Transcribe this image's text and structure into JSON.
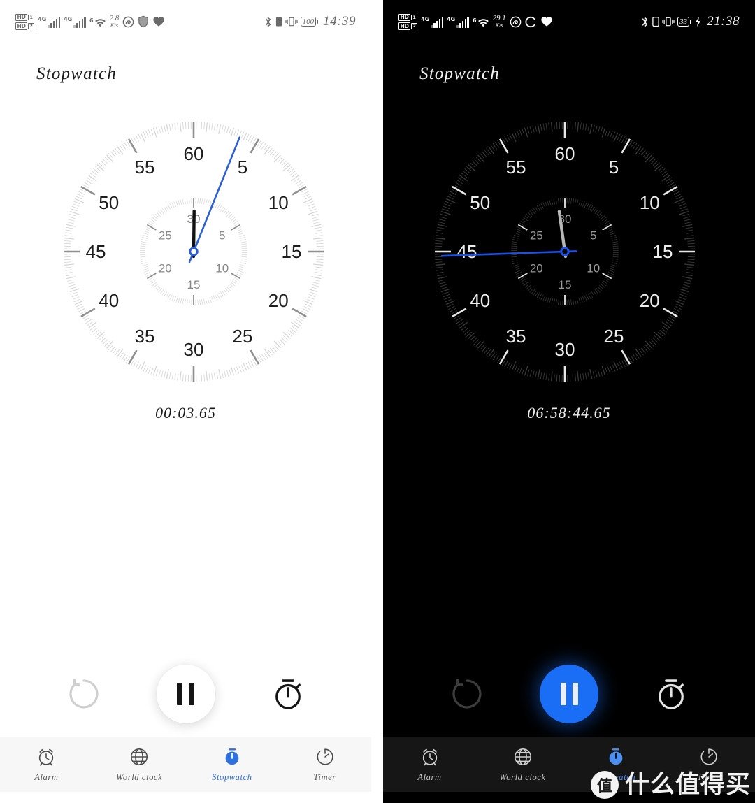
{
  "panels": [
    {
      "id": "light",
      "theme": "light",
      "title": "Stopwatch",
      "status": {
        "hd1": "HD",
        "hd1_sim": "1",
        "hd2": "HD",
        "hd2_sim": "2",
        "net1": "4G",
        "net2": "4G",
        "wifi_sup": "6",
        "speed_value": "2.8",
        "speed_unit": "K/s",
        "icons": [
          "music-icon",
          "shield-icon",
          "heart-icon"
        ],
        "bluetooth": "bluetooth-icon",
        "vibrate": "vibrate-icon",
        "battery_level": "100",
        "charging": false,
        "clock": "14:39"
      },
      "readout": "00:03.65",
      "dial": {
        "outer_numbers": [
          "60",
          "5",
          "10",
          "15",
          "20",
          "25",
          "30",
          "35",
          "40",
          "45",
          "50",
          "55"
        ],
        "inner_numbers": [
          "30",
          "5",
          "10",
          "15",
          "20",
          "25"
        ],
        "second_hand_deg": 21.9,
        "minute_hand_deg": 0.7,
        "second_hand_color": "#2b5fd9",
        "minute_hand_color": "#111111",
        "tick_color": "#d7d7d7",
        "major_tick_color": "#8f8f8f",
        "number_color": "#1d1d1d",
        "inner_number_color": "#888888"
      },
      "controls": {
        "reset": "reset-button",
        "pause": "pause-button",
        "lap": "lap-button"
      },
      "nav": [
        {
          "label": "Alarm",
          "icon": "alarm-clock-icon",
          "active": false
        },
        {
          "label": "World clock",
          "icon": "globe-icon",
          "active": false
        },
        {
          "label": "Stopwatch",
          "icon": "stopwatch-icon",
          "active": true
        },
        {
          "label": "Timer",
          "icon": "timer-icon",
          "active": false
        }
      ]
    },
    {
      "id": "dark",
      "theme": "dark",
      "title": "Stopwatch",
      "status": {
        "hd1": "HD",
        "hd1_sim": "1",
        "hd2": "HD",
        "hd2_sim": "2",
        "net1": "4G",
        "net2": "4G",
        "wifi_sup": "6",
        "speed_value": "29.1",
        "speed_unit": "K/s",
        "icons": [
          "music-icon",
          "sync-icon",
          "heart-icon"
        ],
        "bluetooth": "bluetooth-icon",
        "vibrate": "vibrate-icon",
        "battery_level": "33",
        "charging": true,
        "clock": "21:38"
      },
      "readout": "06:58:44.65",
      "dial": {
        "outer_numbers": [
          "60",
          "5",
          "10",
          "15",
          "20",
          "25",
          "30",
          "35",
          "40",
          "45",
          "50",
          "55"
        ],
        "inner_numbers": [
          "30",
          "5",
          "10",
          "15",
          "20",
          "25"
        ],
        "second_hand_deg": 268.0,
        "minute_hand_deg": 352.0,
        "second_hand_color": "#1a52e8",
        "minute_hand_color": "#b6b6b6",
        "tick_color": "#3a3a3a",
        "major_tick_color": "#e8e8e8",
        "number_color": "#ededed",
        "inner_number_color": "#9a9a9a"
      },
      "controls": {
        "reset": "reset-button",
        "pause": "pause-button",
        "lap": "lap-button"
      },
      "nav": [
        {
          "label": "Alarm",
          "icon": "alarm-clock-icon",
          "active": false
        },
        {
          "label": "World clock",
          "icon": "globe-icon",
          "active": false
        },
        {
          "label": "Stopwatch",
          "icon": "stopwatch-icon",
          "active": true
        },
        {
          "label": "Timer",
          "icon": "timer-icon",
          "active": false
        }
      ]
    }
  ],
  "watermark": {
    "badge": "值",
    "text": "什么值得买"
  },
  "colors": {
    "accent_light": "#2f6fe0",
    "accent_dark": "#1a6ef5",
    "hand_blue": "#2b5fd9"
  }
}
